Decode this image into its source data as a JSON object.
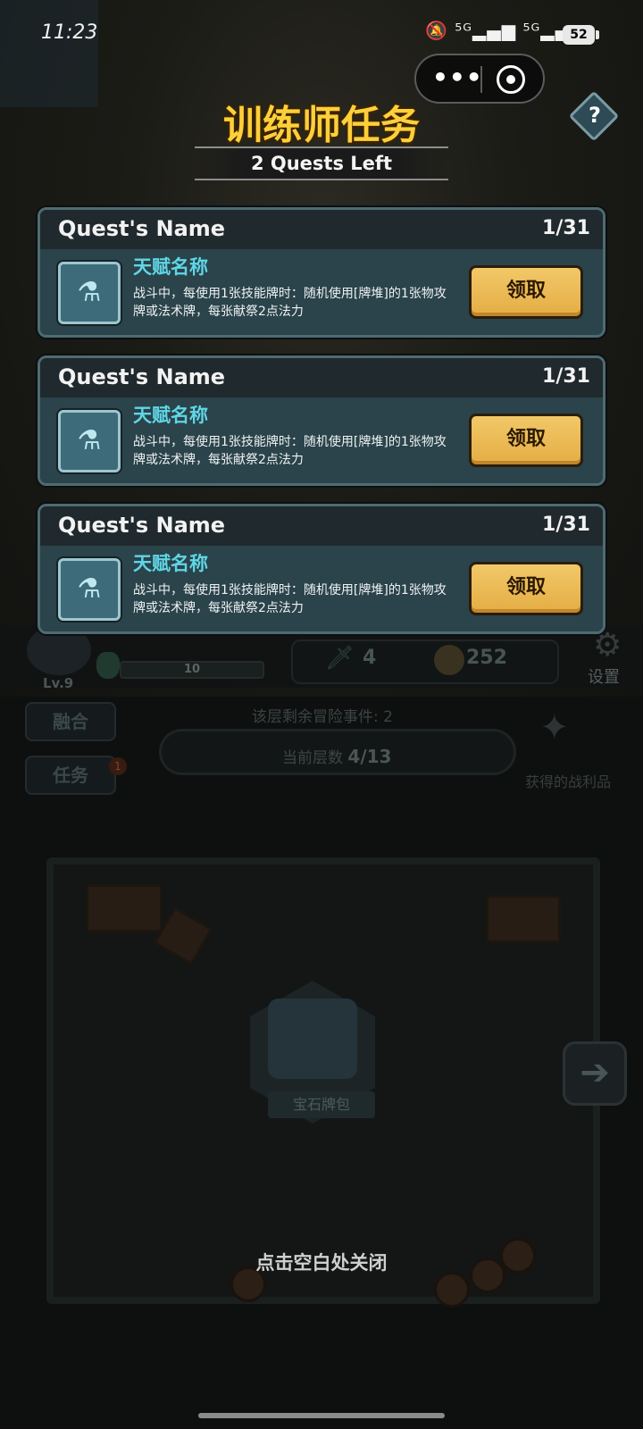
{
  "status_bar": {
    "time": "11:23",
    "signal_text": "🔕 ⁵ᴳ▂▄▆ ⁵ᴳ▂▄▆",
    "battery": "52"
  },
  "mini_program_capsule": {
    "more_icon": "•••",
    "close_icon": "target-icon"
  },
  "panel": {
    "title": "训练师任务",
    "subtitle": "2 Quests Left",
    "help_label": "?"
  },
  "quests": [
    {
      "name": "Quest's Name",
      "progress": "1/31",
      "talent_name": "天赋名称",
      "description": "战斗中，每使用1张技能牌时：随机使用[牌堆]的1张物攻牌或法术牌，每张献祭2点法力",
      "button": "领取"
    },
    {
      "name": "Quest's Name",
      "progress": "1/31",
      "talent_name": "天赋名称",
      "description": "战斗中，每使用1张技能牌时：随机使用[牌堆]的1张物攻牌或法术牌，每张献祭2点法力",
      "button": "领取"
    },
    {
      "name": "Quest's Name",
      "progress": "1/31",
      "talent_name": "天赋名称",
      "description": "战斗中，每使用1张技能牌时：随机使用[牌堆]的1张物攻牌或法术牌，每张献祭2点法力",
      "button": "领取"
    }
  ],
  "hud": {
    "level": "Lv.9",
    "exp": "10",
    "exp_fraction": 0.0,
    "swords": "4",
    "coins": "252",
    "settings": "设置"
  },
  "side": {
    "fuse_label": "融合",
    "task_label": "任务",
    "task_badge": "1"
  },
  "floor": {
    "remaining_events_label": "该层剩余冒险事件:",
    "remaining_events_value": "2",
    "current_floor_label": "当前层数",
    "current_floor_value": "4/13",
    "loot_label": "获得的战利品"
  },
  "map": {
    "gem_bag_label": "宝石牌包",
    "next_icon": "arrow-right-icon"
  },
  "close_hint": "点击空白处关闭",
  "colors": {
    "title_gold": "#ffcf3a",
    "talent_cyan": "#5fd6e6",
    "button_gold": "#e4ad44",
    "card_bg": "#2b434a"
  }
}
